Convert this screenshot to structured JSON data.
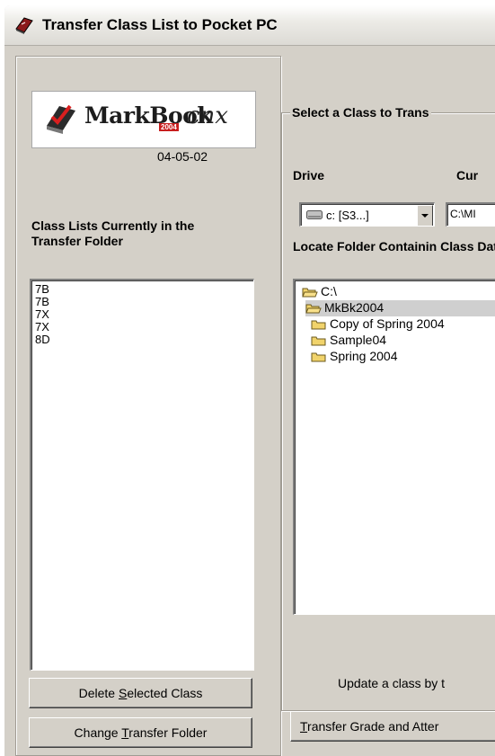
{
  "window": {
    "title": "Transfer Class List to Pocket PC"
  },
  "logo": {
    "text": "MarkBook",
    "year": "2004",
    "suffix": "cnx"
  },
  "version_date": "04-05-02",
  "left_panel": {
    "label": "Class Lists Currently in the Transfer Folder",
    "class_lists": [
      "7B",
      "7B",
      "7X",
      "7X",
      "8D"
    ],
    "delete_button": {
      "prefix": "Delete ",
      "accel": "S",
      "suffix": "elected Class"
    },
    "change_button": {
      "prefix": "Change ",
      "accel": "T",
      "suffix": "ransfer Folder"
    }
  },
  "right_panel": {
    "group_title": "Select a Class to Trans",
    "drive_label": "Drive",
    "current_label": "Cur",
    "drive_value": "c: [S3...]",
    "current_path": "C:\\MI",
    "folder_label": "Locate Folder Containin Class Data",
    "folders": [
      {
        "name": "C:\\",
        "open": true,
        "level": 0,
        "selected": false
      },
      {
        "name": "MkBk2004",
        "open": true,
        "level": 1,
        "selected": true
      },
      {
        "name": "Copy of Spring 2004",
        "open": false,
        "level": 1,
        "selected": false
      },
      {
        "name": "Sample04",
        "open": false,
        "level": 1,
        "selected": false
      },
      {
        "name": "Spring 2004",
        "open": false,
        "level": 1,
        "selected": false
      }
    ],
    "status_text": "Update a class by t",
    "transfer_button": {
      "accel": "T",
      "suffix": "ransfer Grade and Atter"
    }
  }
}
